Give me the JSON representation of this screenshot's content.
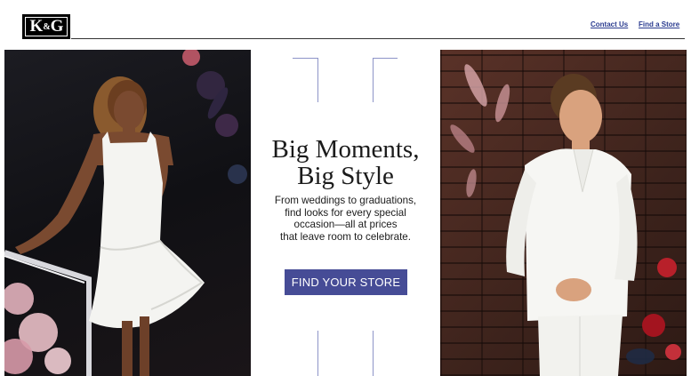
{
  "header": {
    "logo": {
      "left": "K",
      "amp": "&",
      "right": "G"
    },
    "nav": {
      "contact_us": "Contact Us",
      "find_a_store": "Find a Store"
    }
  },
  "hero": {
    "headline_line1": "Big Moments,",
    "headline_line2": "Big Style",
    "subcopy_lines": [
      "From weddings to graduations,",
      "find looks for every special",
      "occasion—all at prices",
      "that leave room to celebrate."
    ],
    "cta_label": "FIND YOUR STORE",
    "left_image": "woman-in-white-dress-photo",
    "right_image": "man-in-white-suit-photo"
  },
  "colors": {
    "nav_link": "#2a3b8f",
    "cta_background": "#464c96",
    "frame_lines": "#8d94c8",
    "header_rule": "#333333"
  }
}
